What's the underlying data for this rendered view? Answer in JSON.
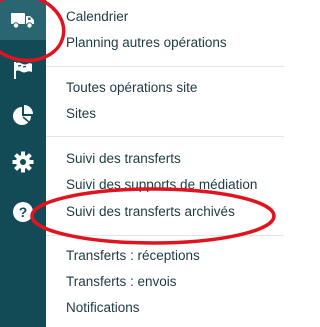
{
  "rail": {
    "icons": [
      {
        "name": "truck-icon",
        "active": true
      },
      {
        "name": "flag-icon",
        "active": false
      },
      {
        "name": "pie-chart-icon",
        "active": false
      },
      {
        "name": "gear-icon",
        "active": false
      },
      {
        "name": "help-icon",
        "active": false
      }
    ]
  },
  "menu": {
    "group1": [
      "Calendrier",
      "Planning autres opérations"
    ],
    "group2": [
      "Toutes opérations site",
      "Sites"
    ],
    "group3": [
      "Suivi des transferts",
      "Suivi des supports de médiation",
      "Suivi des transferts archivés"
    ],
    "group4": [
      "Transferts : réceptions",
      "Transferts : envois",
      "Notifications"
    ]
  },
  "colors": {
    "rail": "#124a55",
    "rail_active": "#2a6672",
    "text": "#1d3a44",
    "annotation": "#e0141e"
  }
}
